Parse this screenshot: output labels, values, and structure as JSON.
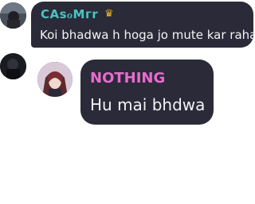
{
  "messages": [
    {
      "author": "CAsℴMгr",
      "badge_icon": "crown-icon",
      "text": "Koi bhadwa h hoga jo mute kar raha"
    },
    {
      "author": "NOTHING",
      "text": "Hu mai bhdwa"
    }
  ],
  "colors": {
    "bubble_bg": "#2b2a38",
    "author1": "#47c6c2",
    "author2": "#e86bcf",
    "crown": "#e8b62c",
    "text": "#f4f4f6"
  }
}
